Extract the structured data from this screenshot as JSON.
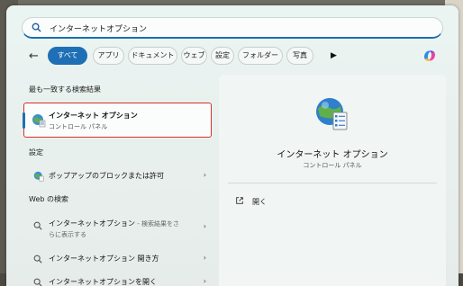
{
  "search": {
    "query": "インターネットオプション"
  },
  "filters": {
    "back_icon": "back-arrow-icon",
    "chips": [
      "すべて",
      "アプリ",
      "ドキュメント",
      "ウェブ",
      "設定",
      "フォルダー",
      "写真"
    ],
    "active_chip": "すべて",
    "more_icon": "play-icon",
    "copilot_icon": "copilot-icon"
  },
  "best_match": {
    "section_title": "最も一致する検索結果",
    "title": "インターネット オプション",
    "subtitle": "コントロール パネル"
  },
  "settings": {
    "section_title": "設定",
    "items": [
      {
        "label": "ポップアップのブロックまたは許可"
      }
    ]
  },
  "web": {
    "section_title": "Web の検索",
    "items": [
      {
        "label": "インターネットオプション",
        "suffix": " - 検索結果をさらに表示する"
      },
      {
        "label": "インターネットオプション 開き方"
      },
      {
        "label": "インターネットオプションを開く"
      }
    ]
  },
  "detail": {
    "title": "インターネット オプション",
    "subtitle": "コントロール パネル",
    "actions": [
      {
        "label": "開く",
        "icon": "open-external-icon"
      }
    ]
  },
  "colors": {
    "accent": "#1f6fb6",
    "highlight_border": "#d0342c"
  }
}
